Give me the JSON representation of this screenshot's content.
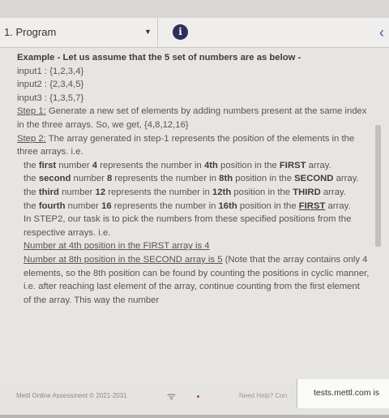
{
  "header": {
    "question_label": "1. Program",
    "info_icon": "i",
    "collapse_icon": "‹"
  },
  "content": {
    "example_heading": "Example - Let us assume that the 5 set of numbers are as below -",
    "input1": "input1 : {1,2,3,4}",
    "input2": "input2 : {2,3,4,5}",
    "input3": "input3 : {1,3,5,7}",
    "step1_label": "Step 1:",
    "step1_text": " Generate a new set of elements by adding numbers present at the same index in the three arrays. So, we get, {4,8,12,16}",
    "step2_label": "Step 2:",
    "step2_text": " The array generated in step-1 represents the position of the elements in the three arrays. i.e.",
    "line1": {
      "a": "the ",
      "b": "first",
      "c": " number ",
      "d": "4",
      "e": " represents the number in ",
      "f": "4th",
      "g": " position in the ",
      "h": "FIRST",
      "i": " array."
    },
    "line2": {
      "a": "the ",
      "b": "second",
      "c": " number ",
      "d": "8",
      "e": " represents the number in ",
      "f": "8th",
      "g": " position in the ",
      "h": "SECOND",
      "i": " array."
    },
    "line3": {
      "a": "the ",
      "b": "third",
      "c": " number ",
      "d": "12",
      "e": " represents the number in ",
      "f": "12th",
      "g": " position in the ",
      "h": "THIRD",
      "i": " array."
    },
    "line4": {
      "a": "the ",
      "b": "fourth",
      "c": " number ",
      "d": "16",
      "e": " represents the number in ",
      "f": "16th",
      "g": " position in the ",
      "h": "FIRST",
      "i": " array."
    },
    "step2_note": "In STEP2, our task is to pick the numbers from these specified positions from the respective arrays. i.e.",
    "pick1": "Number at 4th position in the FIRST array is 4",
    "pick2": "Number at 8th position in the SECOND array is 5",
    "pick2_note": " (Note that the array contains only 4 elements, so the 8th position can be found by counting the positions in cyclic manner, i.e. after reaching last element of the array, continue counting from the first element of the array. This way the number"
  },
  "footer": {
    "brand": "Mettl Online Assessment © 2021-2031",
    "need_help": "Need Help? Con",
    "url": "tests.mettl.com is"
  }
}
